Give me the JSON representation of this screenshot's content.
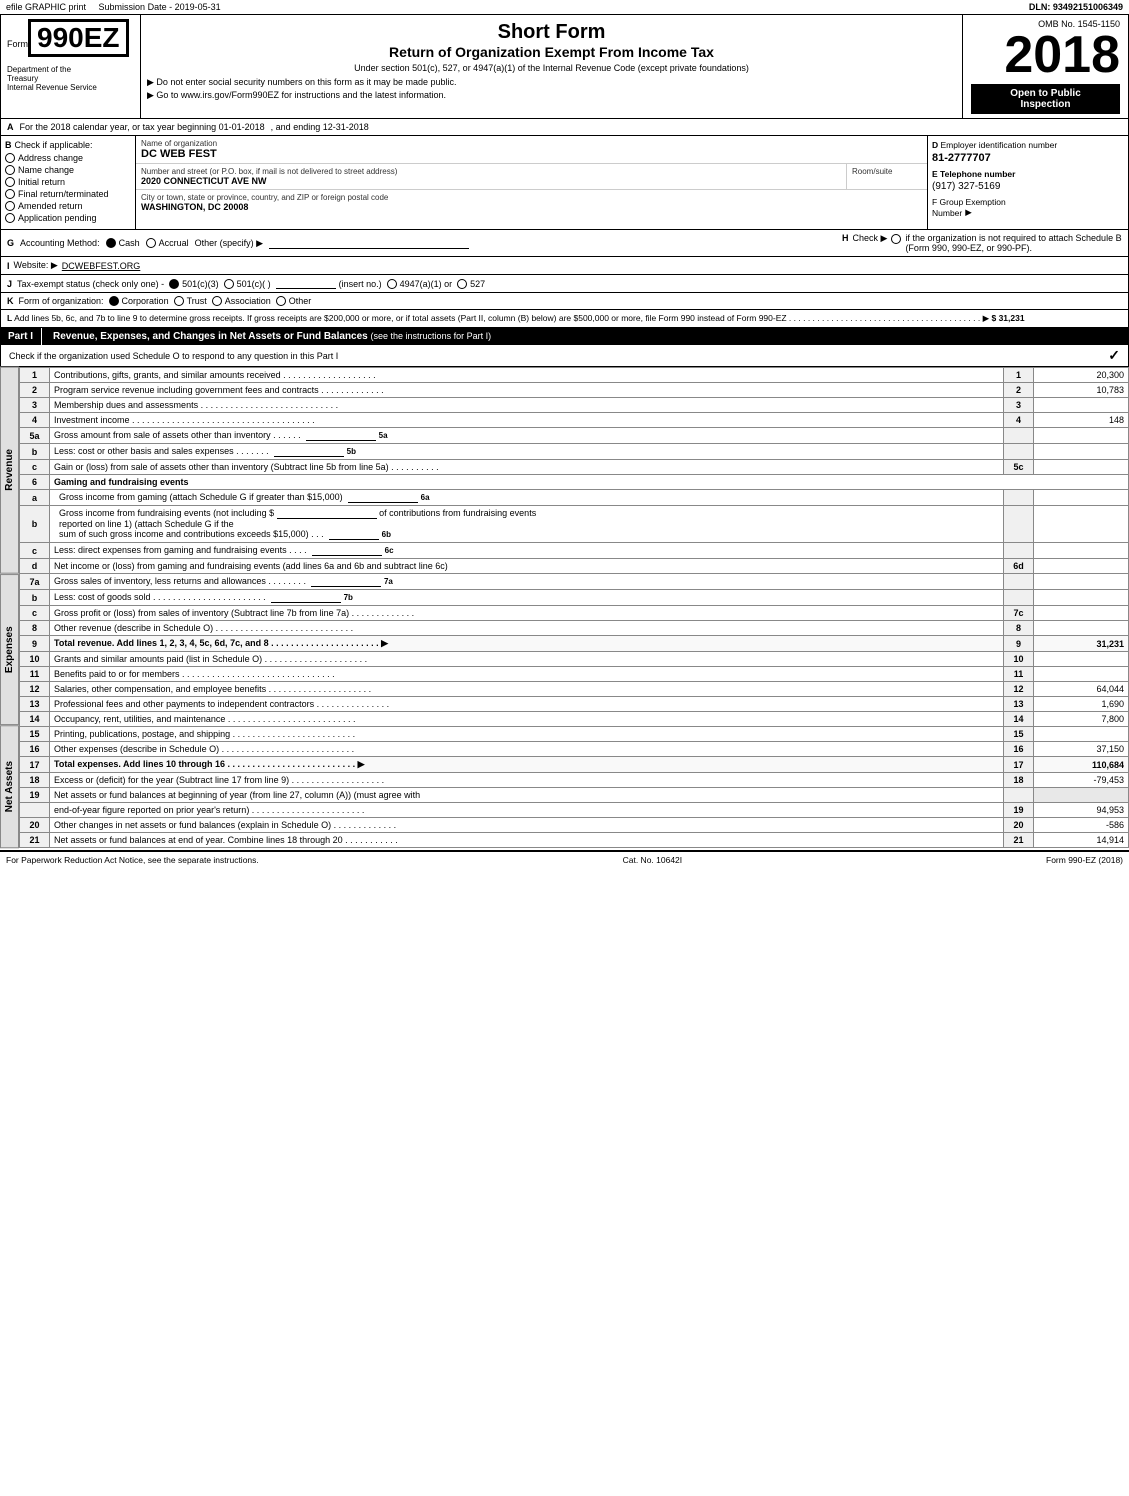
{
  "topBar": {
    "left1": "efile GRAPHIC print",
    "left2": "Submission Date - 2019-05-31",
    "right": "DLN: 93492151006349"
  },
  "formHeader": {
    "formLabel": "Form",
    "formNumber": "990EZ",
    "shortFormTitle": "Short Form",
    "mainTitle": "Return of Organization Exempt From Income Tax",
    "subtitle": "Under section 501(c), 527, or 4947(a)(1) of the Internal Revenue Code (except private foundations)",
    "instruction1": "▶ Do not enter social security numbers on this form as it may be made public.",
    "instruction2": "▶ Go to www.irs.gov/Form990EZ for instructions and the latest information.",
    "ombNo": "OMB No. 1545-1150",
    "year": "2018",
    "openToPublic": "Open to Public",
    "inspection": "Inspection",
    "deptLine1": "Department of the",
    "deptLine2": "Treasury",
    "deptLine3": "Internal Revenue Service"
  },
  "sectionA": {
    "label": "A",
    "text": "For the 2018 calendar year, or tax year beginning 01-01-2018",
    "andEnding": ", and ending 12-31-2018"
  },
  "sectionB": {
    "label": "B",
    "checkLabel": "Check if applicable:",
    "items": [
      {
        "label": "Address change",
        "checked": false
      },
      {
        "label": "Name change",
        "checked": false
      },
      {
        "label": "Initial return",
        "checked": false
      },
      {
        "label": "Final return/terminated",
        "checked": false
      },
      {
        "label": "Amended return",
        "checked": false
      },
      {
        "label": "Application pending",
        "checked": false
      }
    ]
  },
  "sectionC": {
    "label": "C",
    "nameLabel": "Name of organization",
    "nameValue": "DC WEB FEST",
    "streetLabel": "Number and street (or P.O. box, if mail is not delivered to street address)",
    "streetValue": "2020 CONNECTICUT AVE NW",
    "roomSuiteLabel": "Room/suite",
    "roomSuiteValue": "",
    "cityLabel": "City or town, state or province, country, and ZIP or foreign postal code",
    "cityValue": "WASHINGTON, DC  20008"
  },
  "sectionD": {
    "label": "D",
    "employerIdLabel": "Employer identification number",
    "employerIdValue": "81-2777707",
    "telephoneLabel": "E Telephone number",
    "telephoneValue": "(917) 327-5169",
    "groupExemptLabel": "F Group Exemption",
    "groupExemptLabel2": "Number",
    "groupExemptArrow": "▶"
  },
  "sectionG": {
    "label": "G",
    "text": "Accounting Method:",
    "cashLabel": "Cash",
    "accrualLabel": "Accrual",
    "otherLabel": "Other (specify) ▶",
    "cashChecked": true,
    "accrualChecked": false
  },
  "sectionH": {
    "label": "H",
    "text": "Check ▶",
    "checkLabel": "if the organization is not required to attach Schedule B",
    "checkLabel2": "(Form 990, 990-EZ, or 990-PF)."
  },
  "sectionI": {
    "label": "I",
    "websiteLabel": "Website: ▶",
    "websiteValue": "DCWEBFEST.ORG"
  },
  "sectionJ": {
    "label": "J",
    "text": "Tax-exempt status (check only one) -",
    "option1": "501(c)(3)",
    "option2": "501(c)(  )",
    "option3": "(insert no.)",
    "option4": "4947(a)(1) or",
    "option5": "527",
    "checked": "501(c)(3)"
  },
  "sectionK": {
    "label": "K",
    "text": "Form of organization:",
    "options": [
      "Corporation",
      "Trust",
      "Association",
      "Other"
    ],
    "checked": "Corporation"
  },
  "sectionL": {
    "text": "Add lines 5b, 6c, and 7b to line 9 to determine gross receipts. If gross receipts are $200,000 or more, or if total assets (Part II, column (B) below) are $500,000 or more, file Form 990 instead of Form 990-EZ",
    "value": "$ 31,231"
  },
  "partI": {
    "label": "Part I",
    "title": "Revenue, Expenses, and Changes in Net Assets or Fund Balances",
    "titleNote": "(see the instructions for Part I)",
    "checkNote": "Check if the organization used Schedule O to respond to any question in this Part I",
    "checkmark": "✓",
    "lines": [
      {
        "num": "1",
        "desc": "Contributions, gifts, grants, and similar amounts received",
        "ref": "1",
        "value": "20,300"
      },
      {
        "num": "2",
        "desc": "Program service revenue including government fees and contracts",
        "ref": "2",
        "value": "10,783"
      },
      {
        "num": "3",
        "desc": "Membership dues and assessments",
        "ref": "3",
        "value": ""
      },
      {
        "num": "4",
        "desc": "Investment income",
        "ref": "4",
        "value": "148"
      },
      {
        "num": "5a",
        "desc": "Gross amount from sale of assets other than inventory",
        "ref": "5a",
        "value": "",
        "inline": true
      },
      {
        "num": "5b",
        "desc": "Less: cost or other basis and sales expenses",
        "ref": "5b",
        "value": "",
        "inline": true
      },
      {
        "num": "5c",
        "desc": "Gain or (loss) from sale of assets other than inventory (Subtract line 5b from line 5a)",
        "ref": "5c",
        "value": ""
      },
      {
        "num": "6",
        "desc": "Gaming and fundraising events",
        "ref": "",
        "value": ""
      },
      {
        "num": "6a",
        "desc": "Gross income from gaming (attach Schedule G if greater than $15,000)",
        "ref": "6a",
        "value": "",
        "inline": true,
        "isIndent": true
      },
      {
        "num": "6b_text",
        "desc": "Gross income from fundraising events (not including $",
        "ref": "",
        "value": ""
      },
      {
        "num": "6b_text2",
        "desc": "of contributions from fundraising events reported on line 1) (attach Schedule G if the",
        "ref": "",
        "value": ""
      },
      {
        "num": "6b_text3",
        "desc": "sum of such gross income and contributions exceeds $15,000)",
        "ref": "6b",
        "value": "",
        "inline": true
      },
      {
        "num": "6c",
        "desc": "Less: direct expenses from gaming and fundraising events",
        "ref": "6c",
        "value": "",
        "inline": true
      },
      {
        "num": "6d",
        "desc": "Net income or (loss) from gaming and fundraising events (add lines 6a and 6b and subtract line 6c)",
        "ref": "6d",
        "value": ""
      },
      {
        "num": "7a",
        "desc": "Gross sales of inventory, less returns and allowances",
        "ref": "7a",
        "value": "",
        "inline": true
      },
      {
        "num": "7b",
        "desc": "Less: cost of goods sold",
        "ref": "7b",
        "value": "",
        "inline": true
      },
      {
        "num": "7c",
        "desc": "Gross profit or (loss) from sales of inventory (Subtract line 7b from line 7a)",
        "ref": "7c",
        "value": ""
      },
      {
        "num": "8",
        "desc": "Other revenue (describe in Schedule O)",
        "ref": "8",
        "value": ""
      },
      {
        "num": "9",
        "desc": "Total revenue. Add lines 1, 2, 3, 4, 5c, 6d, 7c, and 8",
        "ref": "9",
        "value": "31,231",
        "bold": true,
        "arrow": true
      },
      {
        "num": "10",
        "desc": "Grants and similar amounts paid (list in Schedule O)",
        "ref": "10",
        "value": ""
      },
      {
        "num": "11",
        "desc": "Benefits paid to or for members",
        "ref": "11",
        "value": ""
      },
      {
        "num": "12",
        "desc": "Salaries, other compensation, and employee benefits",
        "ref": "12",
        "value": "64,044"
      },
      {
        "num": "13",
        "desc": "Professional fees and other payments to independent contractors",
        "ref": "13",
        "value": "1,690"
      },
      {
        "num": "14",
        "desc": "Occupancy, rent, utilities, and maintenance",
        "ref": "14",
        "value": "7,800"
      },
      {
        "num": "15",
        "desc": "Printing, publications, postage, and shipping",
        "ref": "15",
        "value": ""
      },
      {
        "num": "16",
        "desc": "Other expenses (describe in Schedule O)",
        "ref": "16",
        "value": "37,150"
      },
      {
        "num": "17",
        "desc": "Total expenses. Add lines 10 through 16",
        "ref": "17",
        "value": "110,684",
        "bold": true,
        "arrow": true
      },
      {
        "num": "18",
        "desc": "Excess or (deficit) for the year (Subtract line 17 from line 9)",
        "ref": "18",
        "value": "-79,453"
      },
      {
        "num": "19",
        "desc": "Net assets or fund balances at beginning of year (from line 27, column (A)) (must agree with",
        "ref": "",
        "value": ""
      },
      {
        "num": "19b",
        "desc": "end-of-year figure reported on prior year's return)",
        "ref": "19",
        "value": "94,953"
      },
      {
        "num": "20",
        "desc": "Other changes in net assets or fund balances (explain in Schedule O)",
        "ref": "20",
        "value": "-586"
      },
      {
        "num": "21",
        "desc": "Net assets or fund balances at end of year. Combine lines 18 through 20",
        "ref": "21",
        "value": "14,914"
      }
    ]
  },
  "footer": {
    "leftText": "For Paperwork Reduction Act Notice, see the separate instructions.",
    "catNo": "Cat. No. 10642I",
    "formRef": "Form 990-EZ (2018)"
  }
}
